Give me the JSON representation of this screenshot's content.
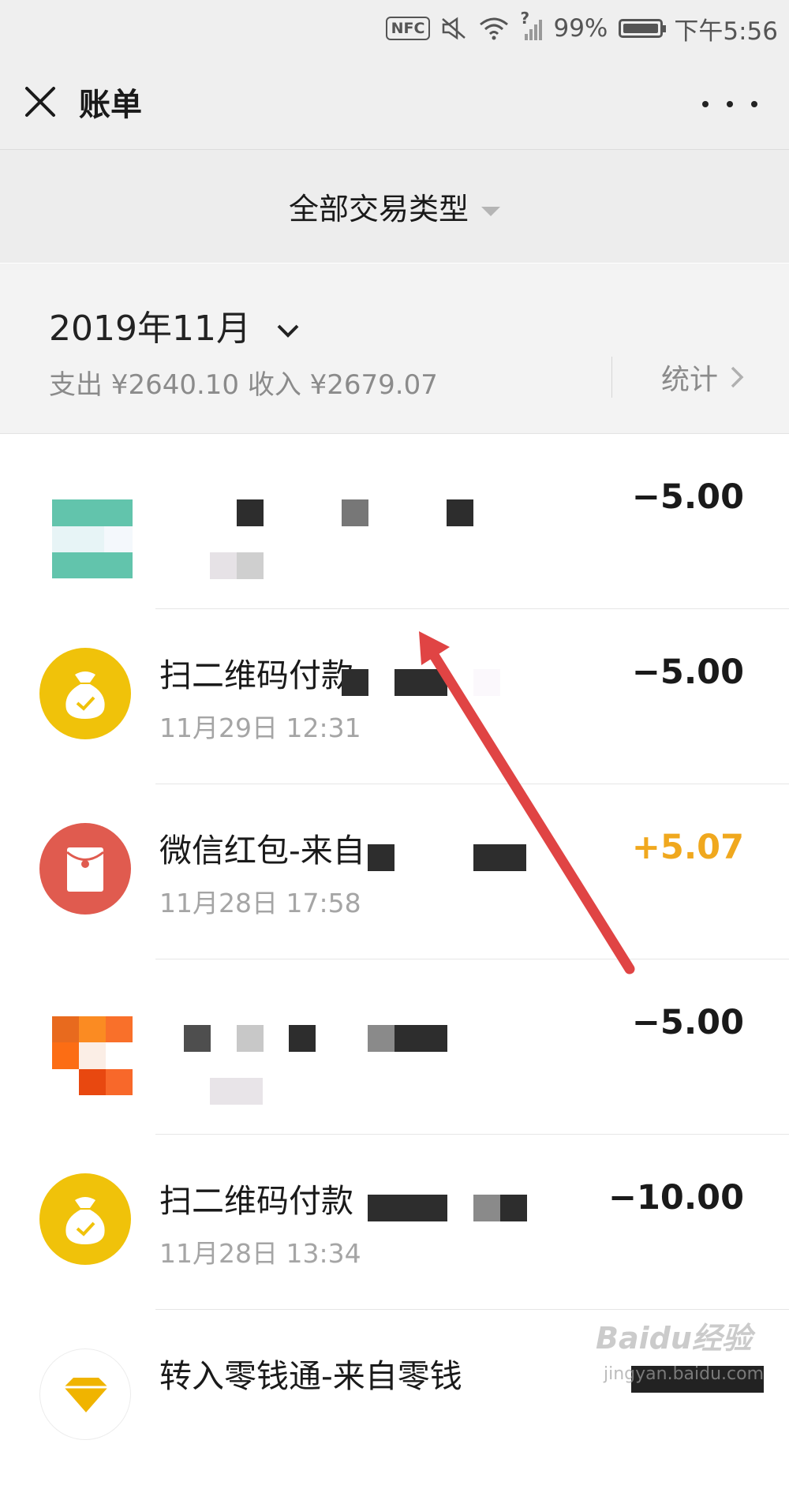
{
  "status_bar": {
    "nfc": "NFC",
    "battery": "99%",
    "time": "下午5:56",
    "signal_label": "?"
  },
  "header": {
    "title": "账单"
  },
  "filter": {
    "label": "全部交易类型"
  },
  "month": {
    "label": "2019年11月",
    "summary": "支出 ¥2640.10 收入 ¥2679.07",
    "stats_label": "统计"
  },
  "transactions": [
    {
      "title": "",
      "time": "",
      "amount": "−5.00",
      "icon": "merchant-logo-teal-icon"
    },
    {
      "title": "扫二维码付款",
      "time": "11月29日 12:31",
      "amount": "−5.00",
      "icon": "money-bag-icon"
    },
    {
      "title": "微信红包-来自",
      "time": "11月28日 17:58",
      "amount": "+5.07",
      "icon": "red-packet-icon"
    },
    {
      "title": "",
      "time": "",
      "amount": "−5.00",
      "icon": "merchant-logo-orange-icon"
    },
    {
      "title": "扫二维码付款",
      "time": "11月28日 13:34",
      "amount": "−10.00",
      "icon": "money-bag-icon"
    },
    {
      "title": "转入零钱通-来自零钱",
      "time": "",
      "amount": "",
      "icon": "diamond-icon"
    }
  ],
  "colors": {
    "income": "#f0a81e",
    "arrow": "#e04444",
    "money_bag": "#f0c20a",
    "red_packet": "#e05b4f"
  },
  "watermark": {
    "text": "Baidu经验",
    "url": "jingyan.baidu.com"
  }
}
